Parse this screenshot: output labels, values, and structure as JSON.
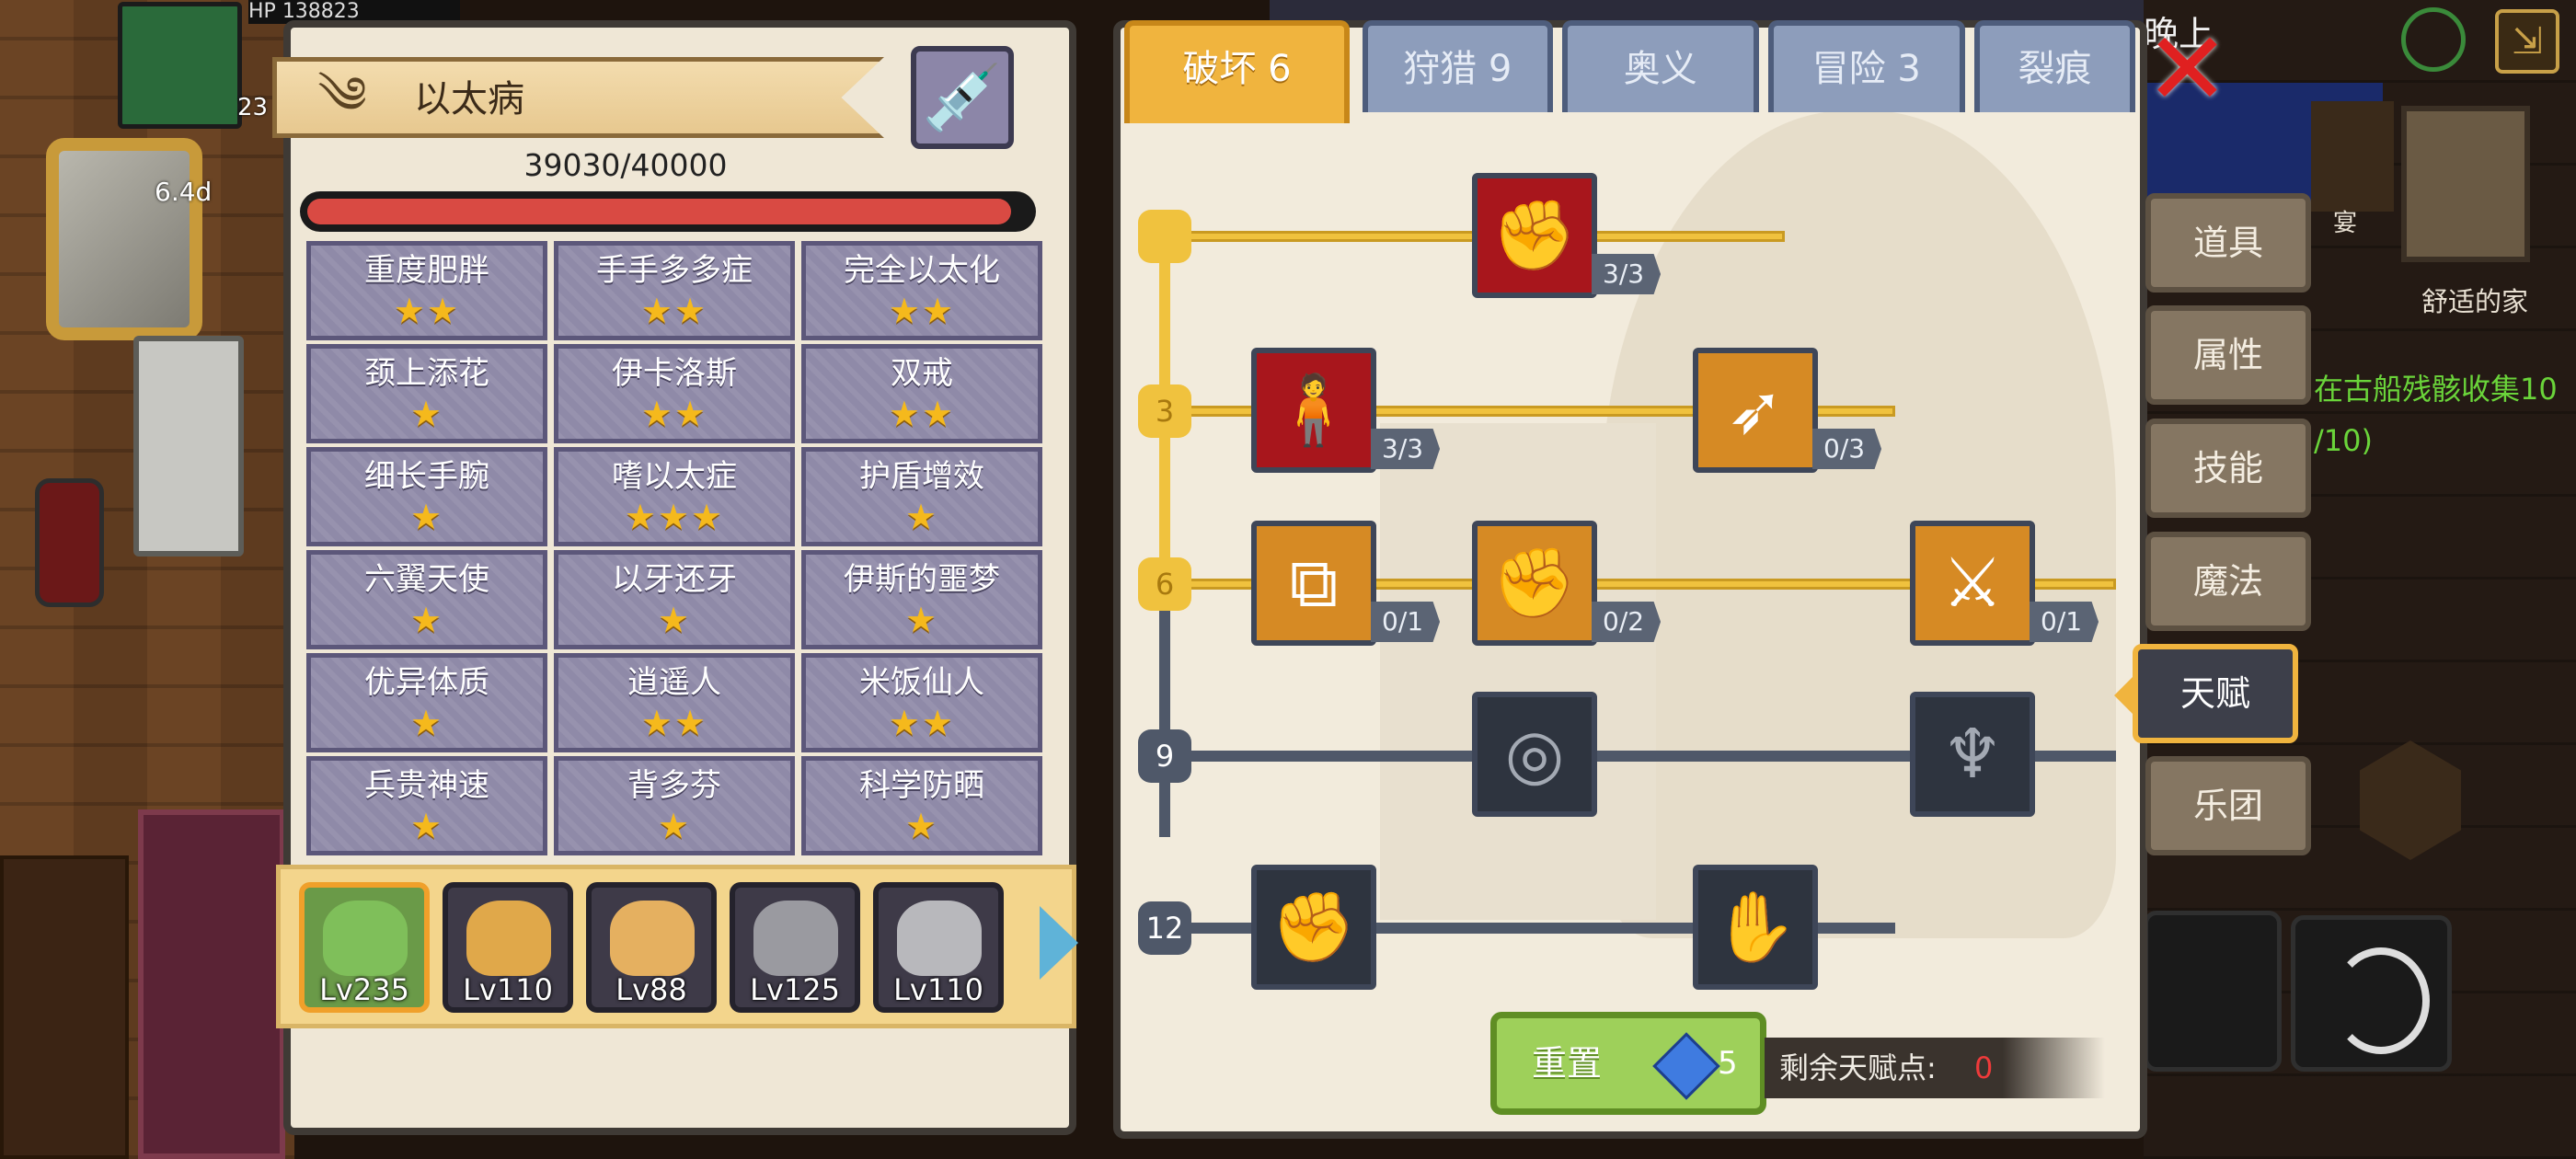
{
  "player": {
    "hp_label": "HP",
    "hp_value": "138823",
    "level_short": "23",
    "exp_value": "6.4d"
  },
  "left_panel": {
    "title": "以太病",
    "hp_text": "39030/40000",
    "hp_fraction": 0.976,
    "traits": [
      {
        "name": "重度肥胖",
        "stars": "★★"
      },
      {
        "name": "手手多多症",
        "stars": "★★"
      },
      {
        "name": "完全以太化",
        "stars": "★★"
      },
      {
        "name": "颈上添花",
        "stars": "★"
      },
      {
        "name": "伊卡洛斯",
        "stars": "★★"
      },
      {
        "name": "双戒",
        "stars": "★★"
      },
      {
        "name": "细长手腕",
        "stars": "★"
      },
      {
        "name": "嗜以太症",
        "stars": "★★★"
      },
      {
        "name": "护盾增效",
        "stars": "★"
      },
      {
        "name": "六翼天使",
        "stars": "★"
      },
      {
        "name": "以牙还牙",
        "stars": "★"
      },
      {
        "name": "伊斯的噩梦",
        "stars": "★"
      },
      {
        "name": "优异体质",
        "stars": "★"
      },
      {
        "name": "逍遥人",
        "stars": "★★"
      },
      {
        "name": "米饭仙人",
        "stars": "★★"
      },
      {
        "name": "兵贵神速",
        "stars": "★"
      },
      {
        "name": "背多芬",
        "stars": "★"
      },
      {
        "name": "科学防晒",
        "stars": "★"
      }
    ],
    "heroes": [
      {
        "level": "Lv235",
        "selected": true,
        "color": "#7fbf5a"
      },
      {
        "level": "Lv110",
        "selected": false,
        "color": "#e0a84a"
      },
      {
        "level": "Lv88",
        "selected": false,
        "color": "#e5b060"
      },
      {
        "level": "Lv125",
        "selected": false,
        "color": "#9a9aa0"
      },
      {
        "level": "Lv110",
        "selected": false,
        "color": "#b8b8bc"
      }
    ]
  },
  "talent_panel": {
    "tabs": [
      "破坏 6",
      "狩猎 9",
      "奥义",
      "冒险 3",
      "裂痕"
    ],
    "active_tab": 0,
    "tiers": [
      "3",
      "6",
      "9",
      "12"
    ],
    "talents": {
      "t0": {
        "count": "3/3",
        "icon": "arm-wrestle-icon"
      },
      "t1a": {
        "count": "3/3",
        "icon": "muscle-body-icon"
      },
      "t1b": {
        "count": "0/3",
        "icon": "arrow-hit-icon"
      },
      "t2a": {
        "count": "0/1",
        "icon": "card-slash-icon"
      },
      "t2b": {
        "count": "0/2",
        "icon": "punch-icon"
      },
      "t2c": {
        "count": "0/1",
        "icon": "sword-slash-icon"
      },
      "t3a": {
        "icon": "ripple-icon"
      },
      "t3b": {
        "icon": "bat-wing-icon"
      },
      "t4a": {
        "icon": "fist-icon"
      },
      "t4b": {
        "icon": "hand-grab-icon"
      }
    },
    "reset_label": "重置",
    "reset_cost": "5",
    "points_label": "剩余天赋点:",
    "points_value": "0"
  },
  "side_menu": [
    "道具",
    "属性",
    "技能",
    "魔法",
    "天赋",
    "乐团"
  ],
  "side_menu_active": 4,
  "world": {
    "top_text": "晚上",
    "home_label": "舒适的家",
    "quest_text": "在古船残骸收集10\n/10)",
    "feast_label": "宴"
  },
  "colors": {
    "accent_gold": "#f0b43e",
    "hp_red": "#d94a43",
    "locked_gray": "#4f5869",
    "close_red": "#e02020",
    "points_red": "#ee3a3a",
    "reset_green": "#9ed05a"
  }
}
